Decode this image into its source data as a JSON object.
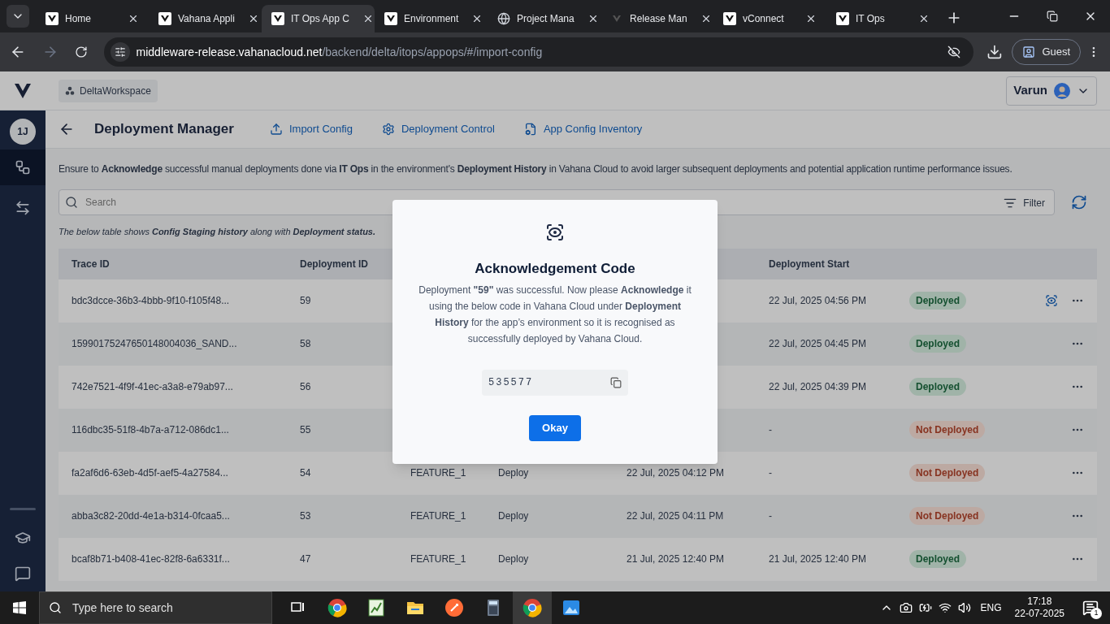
{
  "browser": {
    "tabs": [
      {
        "title": "Home",
        "selected": false
      },
      {
        "title": "Vahana Appli",
        "selected": false
      },
      {
        "title": "IT Ops App C",
        "selected": true
      },
      {
        "title": "Environment",
        "selected": false
      },
      {
        "title": "Project Mana",
        "selected": false
      },
      {
        "title": "Release Man",
        "selected": false
      },
      {
        "title": "vConnect",
        "selected": false
      },
      {
        "title": "IT Ops",
        "selected": false
      }
    ],
    "url_host": "middleware-release.vahanacloud.net",
    "url_path": "/backend/delta/itops/appops/#/import-config",
    "profile": "Guest"
  },
  "header": {
    "workspace": "DeltaWorkspace",
    "user": "Varun"
  },
  "sidebar": {
    "avatar": "1J",
    "items": [
      {
        "selected": true
      },
      {
        "selected": false
      }
    ]
  },
  "page": {
    "title": "Deployment Manager",
    "nav": [
      "Import Config",
      "Deployment Control",
      "App Config Inventory"
    ],
    "notice": "Ensure to **Acknowledge** successful manual deployments done via **IT Ops** in the environment's **Deployment History** in Vahana Cloud to avoid larger subsequent deployments and potential application runtime performance issues.",
    "search": {
      "placeholder": "Search"
    },
    "filter": "Filter",
    "caption": "The below table shows **Config Staging history** along with **Deployment status.**"
  },
  "table": {
    "columns": {
      "trace_id": "Trace ID",
      "deployment_id": "Deployment ID",
      "deployment_start": "Deployment Start"
    },
    "rows": [
      {
        "trace_id": "bdc3dcce-36b3-4bbb-9f10-f105f48...",
        "deployment_id": "59",
        "deployment_start": "22 Jul, 2025 04:56 PM",
        "status": {
          "label": "Deployed",
          "kind": "deployed"
        },
        "acknowledge": true
      },
      {
        "trace_id": "15990175247650148004036_SAND...",
        "deployment_id": "58",
        "deployment_start": "22 Jul, 2025 04:45 PM",
        "status": {
          "label": "Deployed",
          "kind": "deployed"
        },
        "acknowledge": false
      },
      {
        "trace_id": "742e7521-4f9f-41ec-a3a8-e79ab97...",
        "deployment_id": "56",
        "deployment_start": "22 Jul, 2025 04:39 PM",
        "status": {
          "label": "Deployed",
          "kind": "deployed"
        },
        "acknowledge": false
      },
      {
        "trace_id": "116dbc35-51f8-4b7a-a712-086dc1...",
        "deployment_id": "55",
        "deployment_start": "-",
        "status": {
          "label": "Not Deployed",
          "kind": "not_deployed"
        },
        "acknowledge": false
      },
      {
        "trace_id": "fa2af6d6-63eb-4d5f-aef5-4a27584...",
        "deployment_id": "54",
        "column_3": "FEATURE_1",
        "column_4": "Deploy",
        "column_5": "22 Jul, 2025 04:12 PM",
        "deployment_start": "-",
        "status": {
          "label": "Not Deployed",
          "kind": "not_deployed"
        },
        "acknowledge": false
      },
      {
        "trace_id": "abba3c82-20dd-4e1a-b314-0fcaa5...",
        "deployment_id": "53",
        "column_3": "FEATURE_1",
        "column_4": "Deploy",
        "column_5": "22 Jul, 2025 04:11 PM",
        "deployment_start": "-",
        "status": {
          "label": "Not Deployed",
          "kind": "not_deployed"
        },
        "acknowledge": false
      },
      {
        "trace_id": "bcaf8b71-b408-41ec-82f8-6a6331f...",
        "deployment_id": "47",
        "column_3": "FEATURE_1",
        "column_4": "Deploy",
        "column_5": "21 Jul, 2025 12:40 PM",
        "deployment_start": "21 Jul, 2025 12:40 PM",
        "status": {
          "label": "Deployed",
          "kind": "deployed"
        },
        "acknowledge": false
      }
    ]
  },
  "modal": {
    "title": "Acknowledgement Code",
    "message": "Deployment **\"59\"** was successful. Now please **Acknowledge** it using the below code in Vahana Cloud under **Deployment History** for the app’s environment so it is recognised as successfully deployed by Vahana Cloud.",
    "code": "535577",
    "button": "Okay"
  },
  "taskbar": {
    "search_placeholder": "Type here to search",
    "language": "ENG",
    "time": "17:18",
    "date": "22-07-2025",
    "notifications": "1"
  }
}
